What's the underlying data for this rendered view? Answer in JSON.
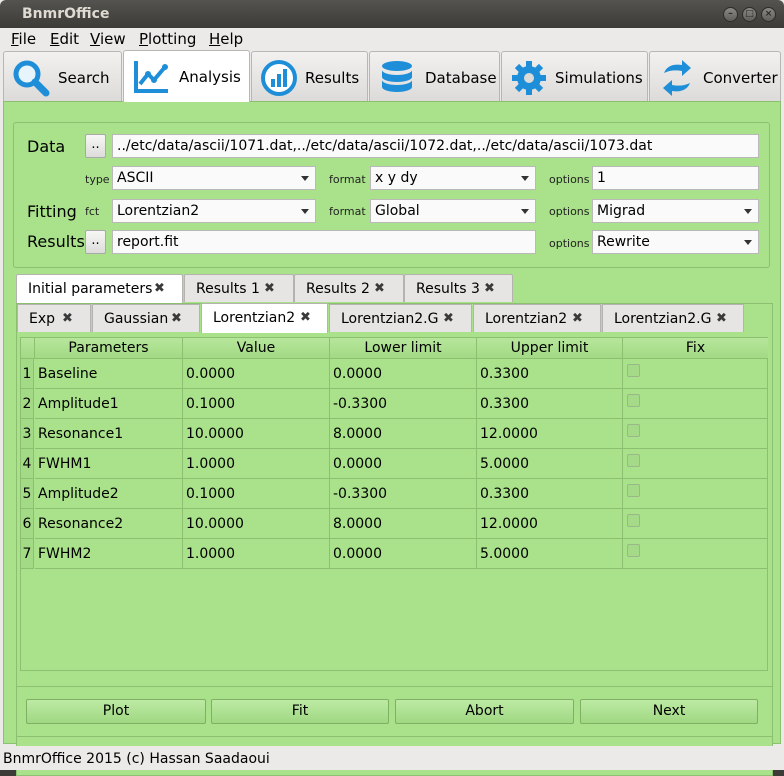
{
  "window": {
    "title": "BnmrOffice"
  },
  "menu": [
    {
      "label": "File",
      "mnemonic": "F",
      "rest": "ile"
    },
    {
      "label": "Edit",
      "mnemonic": "E",
      "rest": "dit"
    },
    {
      "label": "View",
      "mnemonic": "V",
      "rest": "iew"
    },
    {
      "label": "Plotting",
      "mnemonic": "P",
      "rest": "lotting"
    },
    {
      "label": "Help",
      "mnemonic": "H",
      "rest": "elp"
    }
  ],
  "main_tabs": [
    {
      "label": "Search",
      "icon": "search-icon",
      "active": false
    },
    {
      "label": "Analysis",
      "icon": "analysis-chart-icon",
      "active": true
    },
    {
      "label": "Results",
      "icon": "results-bar-icon",
      "active": false
    },
    {
      "label": "Database",
      "icon": "database-icon",
      "active": false
    },
    {
      "label": "Simulations",
      "icon": "gear-icon",
      "active": false
    },
    {
      "label": "Converter",
      "icon": "convert-arrows-icon",
      "active": false
    }
  ],
  "form": {
    "data_label": "Data",
    "browse_label": "..",
    "data_value": "../etc/data/ascii/1071.dat,../etc/data/ascii/1072.dat,../etc/data/ascii/1073.dat",
    "type_label": "type",
    "type_value": "ASCII",
    "format_label": "format",
    "format_value": "x y dy",
    "options_label": "options",
    "options_value": "1",
    "fitting_label": "Fitting",
    "fct_label": "fct",
    "fct_value": "Lorentzian2",
    "fit_format_label": "format",
    "fit_format_value": "Global",
    "fit_options_label": "options",
    "fit_options_value": "Migrad",
    "results_label": "Results",
    "results_browse_label": "..",
    "results_value": "report.fit",
    "results_options_label": "options",
    "results_options_value": "Rewrite"
  },
  "outer_tabs": [
    {
      "label": "Initial parameters",
      "active": true
    },
    {
      "label": "Results 1",
      "active": false
    },
    {
      "label": "Results 2",
      "active": false
    },
    {
      "label": "Results 3",
      "active": false
    }
  ],
  "inner_tabs": [
    {
      "label": "Exp",
      "active": false
    },
    {
      "label": "Gaussian",
      "active": false
    },
    {
      "label": "Lorentzian2",
      "active": true
    },
    {
      "label": "Lorentzian2.G",
      "active": false
    },
    {
      "label": "Lorentzian2",
      "active": false
    },
    {
      "label": "Lorentzian2.G",
      "active": false
    }
  ],
  "table": {
    "headers": [
      "Parameters",
      "Value",
      "Lower limit",
      "Upper limit",
      "Fix"
    ],
    "rows": [
      {
        "num": "1",
        "param": "Baseline",
        "value": "0.0000",
        "lower": "0.0000",
        "upper": "0.3300",
        "fix": false
      },
      {
        "num": "2",
        "param": "Amplitude1",
        "value": "0.1000",
        "lower": "-0.3300",
        "upper": "0.3300",
        "fix": false
      },
      {
        "num": "3",
        "param": "Resonance1",
        "value": "10.0000",
        "lower": "8.0000",
        "upper": "12.0000",
        "fix": false
      },
      {
        "num": "4",
        "param": "FWHM1",
        "value": "1.0000",
        "lower": "0.0000",
        "upper": "5.0000",
        "fix": false
      },
      {
        "num": "5",
        "param": "Amplitude2",
        "value": "0.1000",
        "lower": "-0.3300",
        "upper": "0.3300",
        "fix": false
      },
      {
        "num": "6",
        "param": "Resonance2",
        "value": "10.0000",
        "lower": "8.0000",
        "upper": "12.0000",
        "fix": false
      },
      {
        "num": "7",
        "param": "FWHM2",
        "value": "1.0000",
        "lower": "0.0000",
        "upper": "5.0000",
        "fix": false
      }
    ]
  },
  "buttons": {
    "plot": "Plot",
    "fit": "Fit",
    "abort": "Abort",
    "next": "Next"
  },
  "status": "BnmrOffice 2015 (c) Hassan Saadaoui",
  "colors": {
    "panel": "#a9e28a",
    "titlebar": "#3c3b37"
  }
}
